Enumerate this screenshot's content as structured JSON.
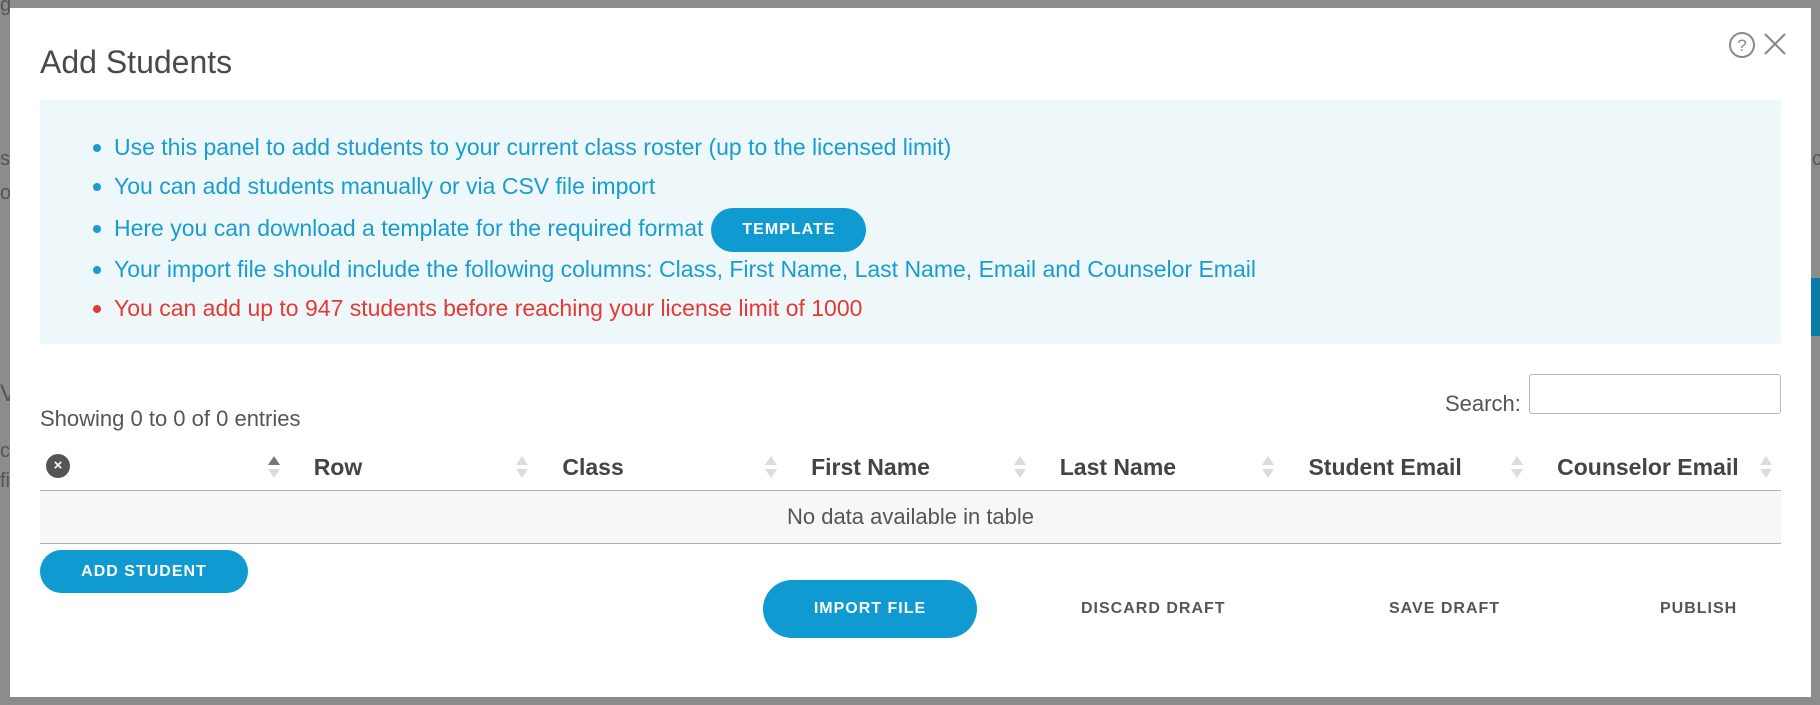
{
  "modal": {
    "title": "Add Students",
    "help_icon": "help-circle-icon",
    "help_glyph": "?",
    "close_icon": "close-icon"
  },
  "info": {
    "items": [
      "Use this panel to add students to your current class roster (up to the licensed limit)",
      "You can add students manually or via CSV file import",
      "Here you can download a template for the required format",
      "Your import file should include the following columns: Class, First Name, Last Name, Email and Counselor Email",
      "You can add up to 947 students before reaching your license limit of 1000"
    ],
    "template_button": "TEMPLATE"
  },
  "table": {
    "showing": "Showing 0 to 0 of 0 entries",
    "search_label": "Search:",
    "search_value": "",
    "clear_glyph": "×",
    "columns": [
      "",
      "Row",
      "Class",
      "First Name",
      "Last Name",
      "Student Email",
      "Counselor Email"
    ],
    "empty_message": "No data available in table"
  },
  "actions": {
    "add_student": "ADD STUDENT",
    "import_file": "IMPORT FILE",
    "discard_draft": "DISCARD DRAFT",
    "save_draft": "SAVE DRAFT",
    "publish": "PUBLISH"
  },
  "colors": {
    "accent": "#0f9ad2",
    "info_text": "#1a9cd0",
    "info_bg": "#eef8fb",
    "warning": "#e53935",
    "overlay": "#8c8c8c"
  }
}
